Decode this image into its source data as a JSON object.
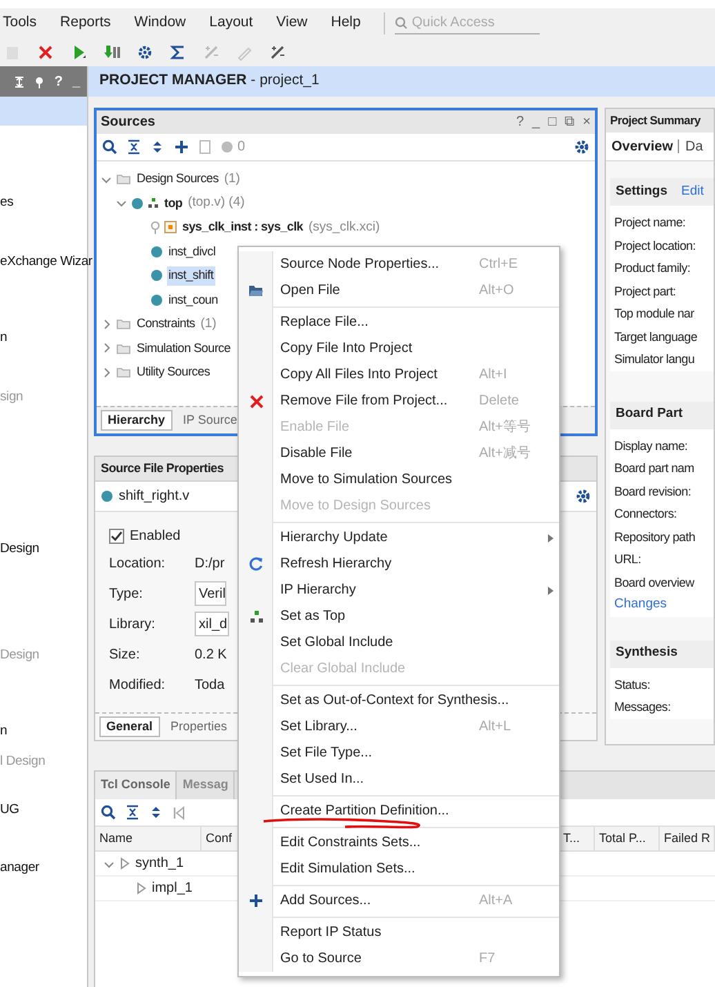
{
  "menu_bar": {
    "items": [
      "Tools",
      "Reports",
      "Window",
      "Layout",
      "View",
      "Help"
    ],
    "search": {
      "placeholder": "Quick Access"
    }
  },
  "toolbar": {
    "buttons": [
      {
        "kind": "page",
        "disabled": true
      },
      {
        "kind": "stop",
        "disabled": false
      },
      {
        "kind": "run",
        "disabled": false
      },
      {
        "kind": "download",
        "disabled": false
      },
      {
        "kind": "gear",
        "disabled": false
      },
      {
        "kind": "sigma",
        "disabled": false
      },
      {
        "kind": "wand",
        "disabled": true
      },
      {
        "kind": "pen",
        "disabled": true
      },
      {
        "kind": "wand",
        "disabled": false
      }
    ]
  },
  "sidebar": {
    "header_buttons": [
      "?",
      "_"
    ],
    "items": [
      {
        "label": "es",
        "disabled": false
      },
      {
        "label": "eXchange Wizar",
        "disabled": false
      },
      {
        "label": "n",
        "disabled": false
      },
      {
        "label": "sign",
        "disabled": true
      },
      {
        "label": "Design",
        "disabled": false
      },
      {
        "label": "Design",
        "disabled": true
      },
      {
        "label": "n",
        "disabled": false
      },
      {
        "label": "l Design",
        "disabled": true
      },
      {
        "label": "UG",
        "disabled": false
      },
      {
        "label": "anager",
        "disabled": false
      }
    ]
  },
  "header": {
    "title": "**PROJECT MANAGER** - project_1"
  },
  "sources": {
    "title": "Sources",
    "header_buttons": [
      "?",
      "_",
      "□",
      "⧉",
      "×"
    ],
    "count": "0",
    "tree": [
      {
        "kind": "folder",
        "name": "Design Sources",
        "detail": "(1)",
        "expanded": true,
        "selected": false,
        "children": [
          {
            "kind": "module",
            "name": "top",
            "detail": "(top.v) (4)",
            "expanded": true,
            "selected": false,
            "children": [
              {
                "kind": "ip",
                "name": "sys_clk_inst : sys_clk",
                "detail": "(sys_clk.xci)",
                "selected": false
              },
              {
                "kind": "instance",
                "name": "inst_divcl",
                "selected": false
              },
              {
                "kind": "instance",
                "name": "inst_shift",
                "selected": true
              },
              {
                "kind": "instance",
                "name": "inst_coun",
                "selected": false
              }
            ]
          }
        ]
      },
      {
        "kind": "folder",
        "name": "Constraints",
        "detail": "(1)",
        "expanded": false,
        "selected": false
      },
      {
        "kind": "folder",
        "name": "Simulation Source",
        "expanded": false,
        "selected": false
      },
      {
        "kind": "folder",
        "name": "Utility Sources",
        "expanded": false,
        "selected": false
      }
    ],
    "tabs": [
      {
        "label": "Hierarchy",
        "selected": true
      },
      {
        "label": "IP Source",
        "selected": false
      }
    ]
  },
  "properties": {
    "title": "Source File Properties",
    "file": "shift_right.v",
    "enabled": {
      "label": "Enabled",
      "checked": true
    },
    "fields": [
      {
        "label": "Location:",
        "value": "D:/pr",
        "kind": "text"
      },
      {
        "label": "Type:",
        "value": "Veril",
        "kind": "dropdown"
      },
      {
        "label": "Library:",
        "value": "xil_d",
        "kind": "dropdown"
      },
      {
        "label": "Size:",
        "value": "0.2 K",
        "kind": "text"
      },
      {
        "label": "Modified:",
        "value": "Toda",
        "kind": "text"
      }
    ],
    "tabs": [
      {
        "label": "General",
        "selected": true
      },
      {
        "label": "Properties",
        "selected": false
      }
    ]
  },
  "summary": {
    "title": "Project Summary",
    "tabs": [
      {
        "label": "Overview",
        "selected": true
      },
      {
        "label": "Da",
        "selected": false
      }
    ],
    "sections": [
      {
        "title": "Settings",
        "action": "Edit",
        "rows": [
          "Project name:",
          "Project location:",
          "Product family:",
          "Project part:",
          "Top module nar",
          "Target language",
          "Simulator langu"
        ]
      },
      {
        "title": "Board Part",
        "rows": [
          "Display name:",
          "Board part nam",
          "Board revision:",
          "Connectors:",
          "Repository path",
          "URL:",
          "Board overview"
        ],
        "link": "Changes"
      },
      {
        "title": "Synthesis",
        "rows": [
          "Status:",
          "Messages:"
        ]
      }
    ]
  },
  "bottom": {
    "tabs": [
      {
        "label": "Tcl Console",
        "selected": true
      },
      {
        "label": "Messag",
        "selected": false
      }
    ],
    "columns": [
      "Name",
      "Conf",
      "T...",
      "Total P...",
      "Failed R"
    ],
    "rows": [
      {
        "name": "synth_1",
        "expanded": true,
        "children": [
          {
            "name": "impl_1"
          }
        ]
      }
    ]
  },
  "context_menu": {
    "items": [
      {
        "kind": "item",
        "label": "Source Node Properties...",
        "shortcut": "Ctrl+E",
        "disabled": false
      },
      {
        "kind": "folder",
        "label": "Open File",
        "shortcut": "Alt+O",
        "disabled": false
      },
      {
        "kind": "separator"
      },
      {
        "kind": "item",
        "label": "Replace File...",
        "disabled": false
      },
      {
        "kind": "item",
        "label": "Copy File Into Project",
        "disabled": false
      },
      {
        "kind": "item",
        "label": "Copy All Files Into Project",
        "shortcut": "Alt+I",
        "disabled": false
      },
      {
        "kind": "cross",
        "label": "Remove File from Project...",
        "shortcut": "Delete",
        "disabled": false
      },
      {
        "kind": "item",
        "label": "Enable File",
        "shortcut": "Alt+等号",
        "disabled": true
      },
      {
        "kind": "item",
        "label": "Disable File",
        "shortcut": "Alt+减号",
        "disabled": false
      },
      {
        "kind": "item",
        "label": "Move to Simulation Sources",
        "disabled": false
      },
      {
        "kind": "item",
        "label": "Move to Design Sources",
        "disabled": true
      },
      {
        "kind": "separator"
      },
      {
        "kind": "item",
        "label": "Hierarchy Update",
        "submenu": true,
        "disabled": false
      },
      {
        "kind": "refresh",
        "label": "Refresh Hierarchy",
        "disabled": false
      },
      {
        "kind": "item",
        "label": "IP Hierarchy",
        "submenu": true,
        "disabled": false
      },
      {
        "kind": "hierarchy",
        "label": "Set as Top",
        "disabled": false
      },
      {
        "kind": "item",
        "label": "Set Global Include",
        "disabled": false
      },
      {
        "kind": "item",
        "label": "Clear Global Include",
        "disabled": true
      },
      {
        "kind": "separator"
      },
      {
        "kind": "item",
        "label": "Set as Out-of-Context for Synthesis...",
        "disabled": false
      },
      {
        "kind": "item",
        "label": "Set Library...",
        "shortcut": "Alt+L",
        "disabled": false
      },
      {
        "kind": "item",
        "label": "Set File Type...",
        "disabled": false
      },
      {
        "kind": "item",
        "label": "Set Used In...",
        "disabled": false
      },
      {
        "kind": "separator"
      },
      {
        "kind": "item",
        "label": "Create Partition Definition...",
        "underlined": true,
        "disabled": false
      },
      {
        "kind": "separator"
      },
      {
        "kind": "item",
        "label": "Edit Constraints Sets...",
        "disabled": false
      },
      {
        "kind": "item",
        "label": "Edit Simulation Sets...",
        "disabled": false
      },
      {
        "kind": "separator"
      },
      {
        "kind": "plus",
        "label": "Add Sources...",
        "shortcut": "Alt+A",
        "disabled": false
      },
      {
        "kind": "separator"
      },
      {
        "kind": "item",
        "label": "Report IP Status",
        "disabled": false
      },
      {
        "kind": "item",
        "label": "Go to Source",
        "shortcut": "F7",
        "disabled": false
      }
    ]
  }
}
